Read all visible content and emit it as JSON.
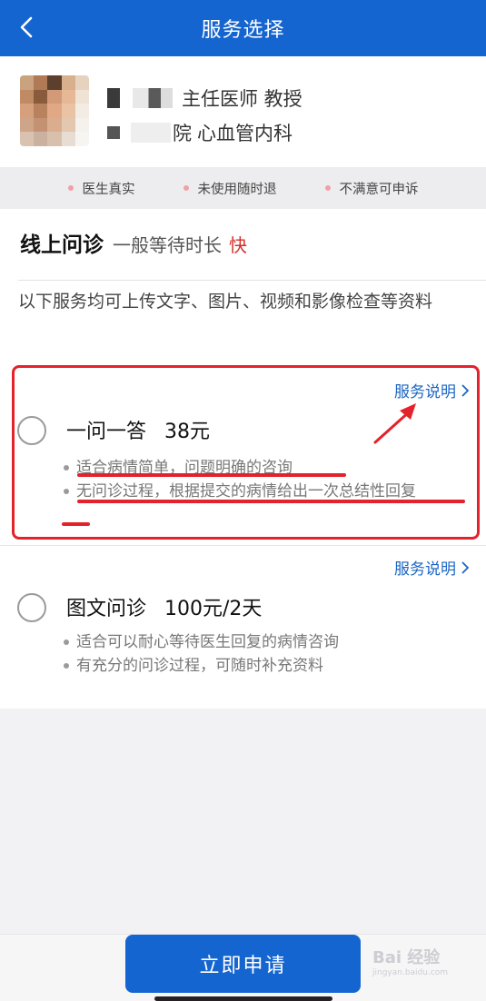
{
  "header": {
    "title": "服务选择",
    "back_icon": "chevron-left-icon"
  },
  "doctor": {
    "title_line": "主任医师 教授",
    "hospital_tail": "院",
    "department": "心血管内科"
  },
  "guarantees": [
    {
      "label": "医生真实"
    },
    {
      "label": "未使用随时退"
    },
    {
      "label": "不满意可申诉"
    }
  ],
  "section": {
    "heading": "线上问诊",
    "wait_label": "一般等待时长",
    "wait_value": "快",
    "description": "以下服务均可上传文字、图片、视频和影像检查等资料"
  },
  "options": [
    {
      "name": "一问一答",
      "price": "38元",
      "link": "服务说明",
      "selected": false,
      "bullets": [
        "适合病情简单，问题明确的咨询",
        "无问诊过程，根据提交的病情给出一次总结性回复"
      ]
    },
    {
      "name": "图文问诊",
      "price": "100元/2天",
      "link": "服务说明",
      "selected": false,
      "bullets": [
        "适合可以耐心等待医生回复的病情咨询",
        "有充分的问诊过程，可随时补充资料"
      ]
    }
  ],
  "footer": {
    "apply_label": "立即申请"
  },
  "watermark": {
    "text": "Bai 经验",
    "sub": "jingyan.baidu.com"
  },
  "colors": {
    "primary": "#1565d0",
    "accent_red": "#e3222c",
    "link": "#1a66c2",
    "fast": "#d4302b"
  }
}
